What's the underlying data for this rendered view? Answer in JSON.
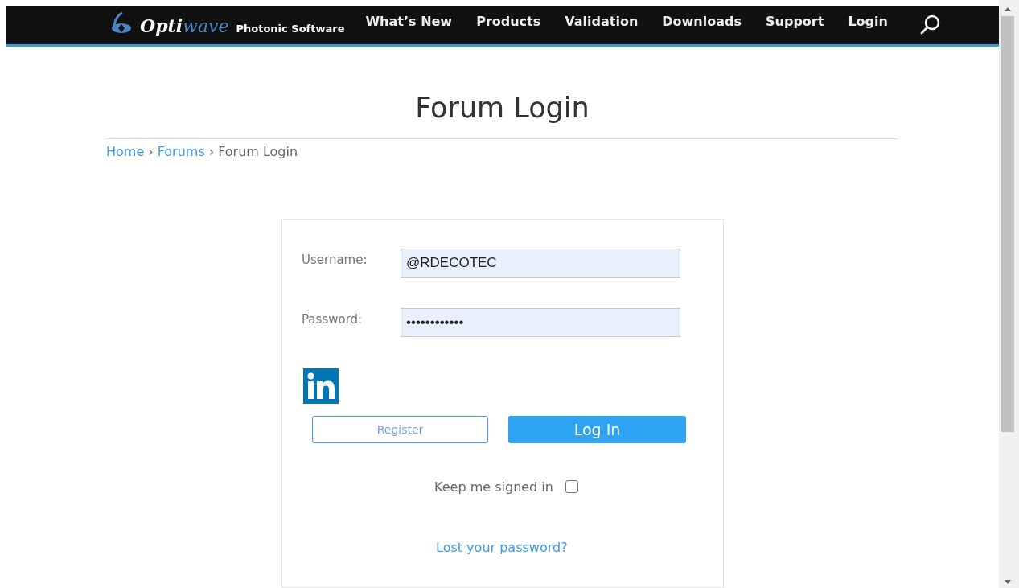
{
  "header": {
    "logo": {
      "part_1": "Opti",
      "part_2": "wave",
      "tagline": "Photonic Software"
    },
    "nav": [
      {
        "label": "What’s New"
      },
      {
        "label": "Products"
      },
      {
        "label": "Validation"
      },
      {
        "label": "Downloads"
      },
      {
        "label": "Support"
      },
      {
        "label": "Login"
      }
    ]
  },
  "page_title": "Forum Login",
  "breadcrumb": [
    {
      "label": "Home",
      "kind": "link"
    },
    {
      "label": "Forums",
      "kind": "link"
    },
    {
      "label": "Forum Login",
      "kind": "current"
    }
  ],
  "breadcrumb_separator": "›",
  "form": {
    "fields": [
      {
        "label": "Username:",
        "value": "@RDECOTEC"
      },
      {
        "label": "Password:",
        "value": "••••••••••••"
      }
    ],
    "register_button": "Register",
    "login_button": "Log In",
    "remember": {
      "label": "Keep me signed in",
      "checked": false
    },
    "lost_password": "Lost your password?"
  }
}
